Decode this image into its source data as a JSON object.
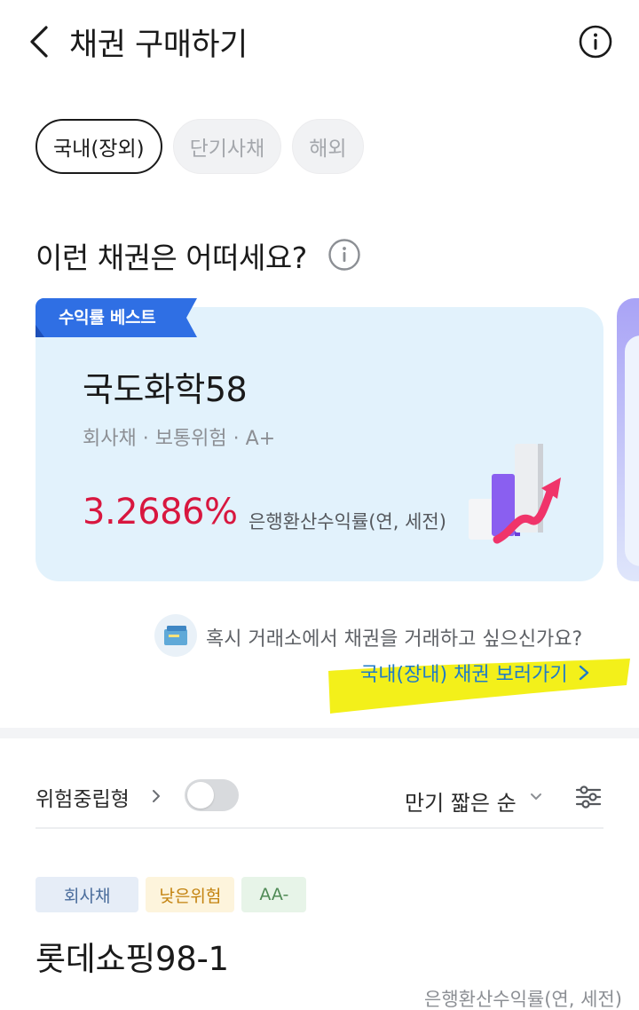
{
  "header": {
    "title": "채권 구매하기",
    "back_icon": "chevron-left-icon",
    "info_icon": "info-icon"
  },
  "tabs": [
    {
      "label": "국내(장외)",
      "active": true
    },
    {
      "label": "단기사채",
      "active": false
    },
    {
      "label": "해외",
      "active": false
    }
  ],
  "recommend": {
    "title": "이런 채권은 어떠세요?",
    "info_icon": "info-icon",
    "card": {
      "badge": "수익률 베스트",
      "name": "국도화학58",
      "meta": "회사채 · 보통위험 · A+",
      "rate": "3.2686%",
      "rate_label": "은행환산수익률(연, 세전)",
      "rate_color": "#d8173f",
      "illustration_icon": "bar-chart-up-icon"
    }
  },
  "exchange": {
    "question": "혹시 거래소에서 채권을 거래하고 싶으신가요?",
    "link": "국내(장내) 채권 보러가기",
    "link_color": "#1f7bc7"
  },
  "filters": {
    "risk_label": "위험중립형",
    "risk_toggle_on": false,
    "sort_label": "만기 짧은 순",
    "filter_icon": "sliders-icon"
  },
  "list": [
    {
      "tags": [
        "회사채",
        "낮은위험",
        "AA-"
      ],
      "name": "롯데쇼핑98-1",
      "rate_label": "은행환산수익률(연, 세전)"
    }
  ]
}
